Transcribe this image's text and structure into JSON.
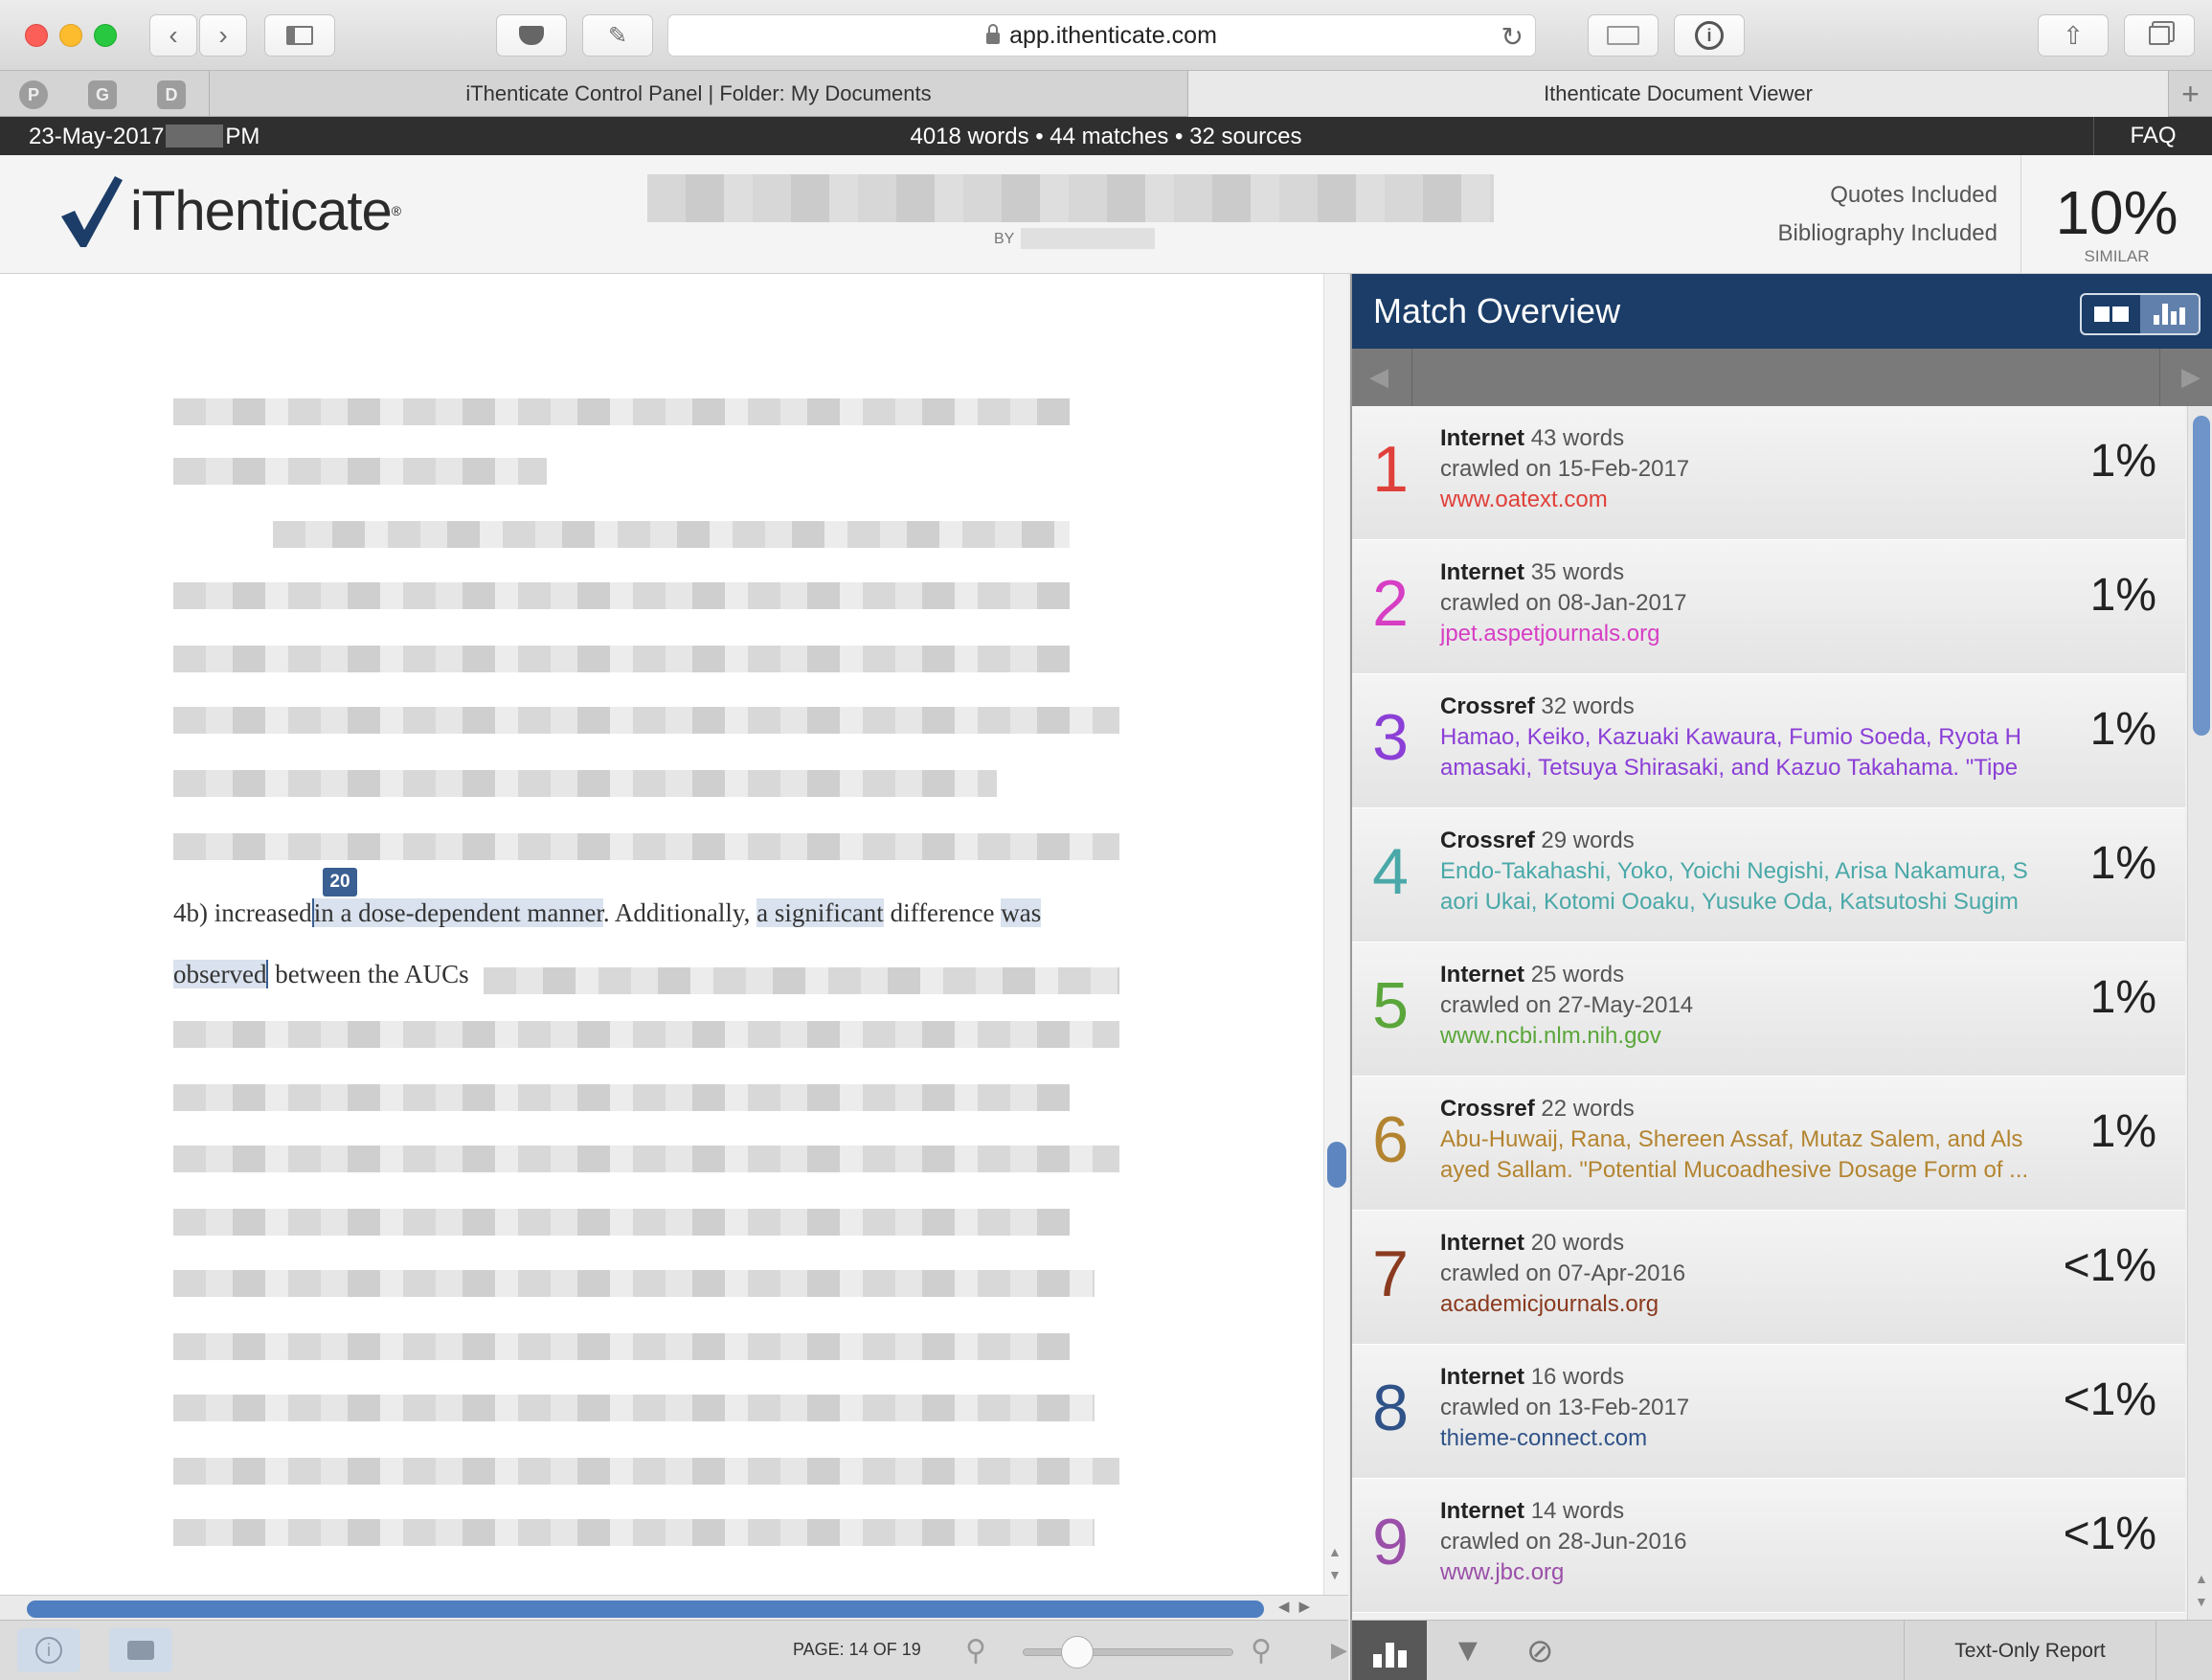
{
  "browser": {
    "url": "app.ithenticate.com",
    "tabs": [
      {
        "label": "iThenticate Control Panel | Folder: My Documents",
        "active": false
      },
      {
        "label": "Ithenticate Document Viewer",
        "active": true
      }
    ],
    "pinned_tabs": [
      "pinterest-icon",
      "G",
      "D"
    ]
  },
  "infobar": {
    "date": "23-May-2017",
    "time_suffix": "PM",
    "stats": "4018 words • 44 matches • 32 sources",
    "faq": "FAQ"
  },
  "header": {
    "logo_text": "iThenticate",
    "by_label": "BY",
    "quotes": "Quotes Included",
    "bibliography": "Bibliography Included",
    "similarity": "10%",
    "similarity_label": "SIMILAR"
  },
  "document": {
    "match_badge": "20",
    "line1_pre": "4b) increased",
    "line1_hl1": "in a dose-dependent manner",
    "line1_mid": ". Additionally, ",
    "line1_hl2": "a significant",
    "line1_mid2": " difference ",
    "line1_hl3": "was",
    "line2_hl": "observed",
    "line2_post": " between the AUCs"
  },
  "toolbar": {
    "page_indicator": "PAGE: 14 OF 19"
  },
  "panel": {
    "title": "Match Overview",
    "text_only_label": "Text-Only Report",
    "matches": [
      {
        "num": "1",
        "type": "Internet",
        "words": "43 words",
        "line2": "crawled on 15-Feb-2017",
        "line3": "www.oatext.com",
        "pct": "1%",
        "color": "#e0403a"
      },
      {
        "num": "2",
        "type": "Internet",
        "words": "35 words",
        "line2": "crawled on 08-Jan-2017",
        "line3": "jpet.aspetjournals.org",
        "pct": "1%",
        "color": "#d63ec4"
      },
      {
        "num": "3",
        "type": "Crossref",
        "words": "32 words",
        "line2": "Hamao, Keiko, Kazuaki Kawaura, Fumio Soeda, Ryota H",
        "line3": "amasaki, Tetsuya Shirasaki, and Kazuo Takahama. \"Tipe",
        "pct": "1%",
        "color": "#8b3fd6"
      },
      {
        "num": "4",
        "type": "Crossref",
        "words": "29 words",
        "line2": "Endo-Takahashi, Yoko, Yoichi Negishi, Arisa Nakamura, S",
        "line3": "aori Ukai, Kotomi Ooaku, Yusuke Oda, Katsutoshi Sugim",
        "pct": "1%",
        "color": "#4aa8a8"
      },
      {
        "num": "5",
        "type": "Internet",
        "words": "25 words",
        "line2": "crawled on 27-May-2014",
        "line3": "www.ncbi.nlm.nih.gov",
        "pct": "1%",
        "color": "#5aa63a"
      },
      {
        "num": "6",
        "type": "Crossref",
        "words": "22 words",
        "line2": "Abu-Huwaij, Rana, Shereen Assaf, Mutaz Salem, and Als",
        "line3": "ayed Sallam. \"Potential Mucoadhesive Dosage Form of ...",
        "pct": "1%",
        "color": "#b38430"
      },
      {
        "num": "7",
        "type": "Internet",
        "words": "20 words",
        "line2": "crawled on 07-Apr-2016",
        "line3": "academicjournals.org",
        "pct": "<1%",
        "color": "#8a3a1e"
      },
      {
        "num": "8",
        "type": "Internet",
        "words": "16 words",
        "line2": "crawled on 13-Feb-2017",
        "line3": "thieme-connect.com",
        "pct": "<1%",
        "color": "#2f5288"
      },
      {
        "num": "9",
        "type": "Internet",
        "words": "14 words",
        "line2": "crawled on 28-Jun-2016",
        "line3": "www.jbc.org",
        "pct": "<1%",
        "color": "#9a4fa8"
      }
    ]
  }
}
